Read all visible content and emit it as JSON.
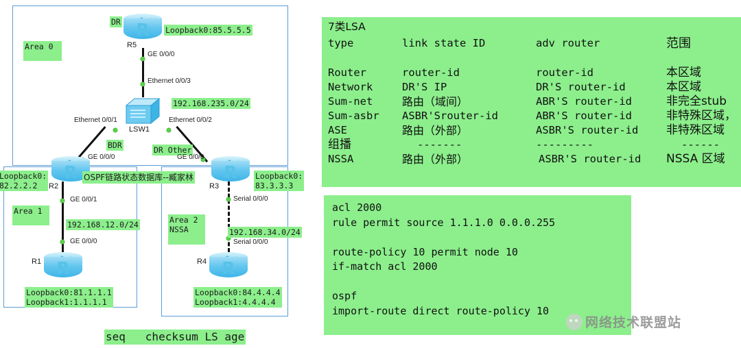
{
  "diagram": {
    "title": "OSPF链路状态数据库--臧家林",
    "areas": [
      {
        "id": "area0",
        "label": "Area 0"
      },
      {
        "id": "area1",
        "label": "Area 1"
      },
      {
        "id": "area2",
        "label": "Area 2\nNSSA"
      }
    ],
    "devices": [
      {
        "id": "r5",
        "name": "R5",
        "type": "router"
      },
      {
        "id": "lsw1",
        "name": "LSW1",
        "type": "switch"
      },
      {
        "id": "r2",
        "name": "R2",
        "type": "router"
      },
      {
        "id": "r3",
        "name": "R3",
        "type": "router"
      },
      {
        "id": "r1",
        "name": "R1",
        "type": "router"
      },
      {
        "id": "r4",
        "name": "R4",
        "type": "router"
      }
    ],
    "roles": [
      {
        "id": "dr",
        "label": "DR"
      },
      {
        "id": "bdr",
        "label": "BDR"
      },
      {
        "id": "dr-other",
        "label": "DR Other"
      }
    ],
    "loopbacks": [
      {
        "id": "r5-lo",
        "label": "Loopback0:85.5.5.5"
      },
      {
        "id": "r2-lo",
        "label": "Loopback0:\n82.2.2.2"
      },
      {
        "id": "r3-lo",
        "label": "Loopback0:\n83.3.3.3"
      },
      {
        "id": "r1-lo",
        "label": "Loopback0:81.1.1.1\nLoopback1:1.1.1.1"
      },
      {
        "id": "r4-lo",
        "label": "Loopback0:84.4.4.4\nLoopback1:4.4.4.4"
      }
    ],
    "subnets": [
      {
        "id": "net-235",
        "label": "192.168.235.0/24"
      },
      {
        "id": "net-12",
        "label": "192.168.12.0/24"
      },
      {
        "id": "net-34",
        "label": "192.168.34.0/24"
      }
    ],
    "interfaces": [
      {
        "id": "r5-ge0",
        "label": "GE 0/0/0"
      },
      {
        "id": "lsw-e003",
        "label": "Ethernet 0/0/3"
      },
      {
        "id": "lsw-e001",
        "label": "Ethernet 0/0/1"
      },
      {
        "id": "lsw-e002",
        "label": "Ethernet 0/0/2"
      },
      {
        "id": "r2-ge0a",
        "label": "GE 0/0/0"
      },
      {
        "id": "r3-ge0a",
        "label": "GE 0/0/0"
      },
      {
        "id": "r2-ge01",
        "label": "GE 0/0/1"
      },
      {
        "id": "r1-ge0",
        "label": "GE 0/0/0"
      },
      {
        "id": "r3-ser",
        "label": "Serial 0/0/0"
      },
      {
        "id": "r4-ser",
        "label": "Serial 0/0/0"
      }
    ],
    "footer_legend": "seq   checksum LS age"
  },
  "lsa_panel": {
    "heading": "7类LSA",
    "columns": [
      "type",
      "link state ID",
      "adv router",
      "范围"
    ],
    "rows": [
      {
        "type": "Router",
        "link_state_id": "router-id",
        "adv_router": "router-id",
        "scope": "本区域"
      },
      {
        "type": "Network",
        "link_state_id": "DR'S IP",
        "adv_router": "DR'S router-id",
        "scope": "本区域"
      },
      {
        "type": "Sum-net",
        "link_state_id": "路由（域间）",
        "adv_router": "ABR'S router-id",
        "scope": "非完全stub"
      },
      {
        "type": "Sum-asbr",
        "link_state_id": "ASBR'Srouter-id",
        "adv_router": "ABR'S router-id",
        "scope": "非特殊区域，"
      },
      {
        "type": "ASE",
        "link_state_id": "路由（外部）",
        "adv_router": "ASBR'S router-id",
        "scope": "非特殊区域"
      },
      {
        "type": "组播",
        "link_state_id": "-------",
        "adv_router": "---------",
        "scope": "------"
      },
      {
        "type": "NSSA",
        "link_state_id": "路由（外部）",
        "adv_router": "ASBR'S router-id",
        "scope": "NSSA 区域"
      }
    ]
  },
  "config_panel": {
    "lines": [
      "acl 2000",
      "rule permit source 1.1.1.0 0.0.0.255",
      "",
      "route-policy 10 permit node 10",
      "if-match acl 2000",
      "",
      "ospf",
      "import-route direct route-policy 10"
    ]
  },
  "watermark": {
    "text": "网络技术联盟站",
    "icon": "wechat-icon"
  },
  "colors": {
    "highlight": "#8cef8c",
    "area_border": "#5b9bd5",
    "device_blue": "#63c6ef",
    "link": "#111111",
    "port_dot": "#5ad14a"
  }
}
